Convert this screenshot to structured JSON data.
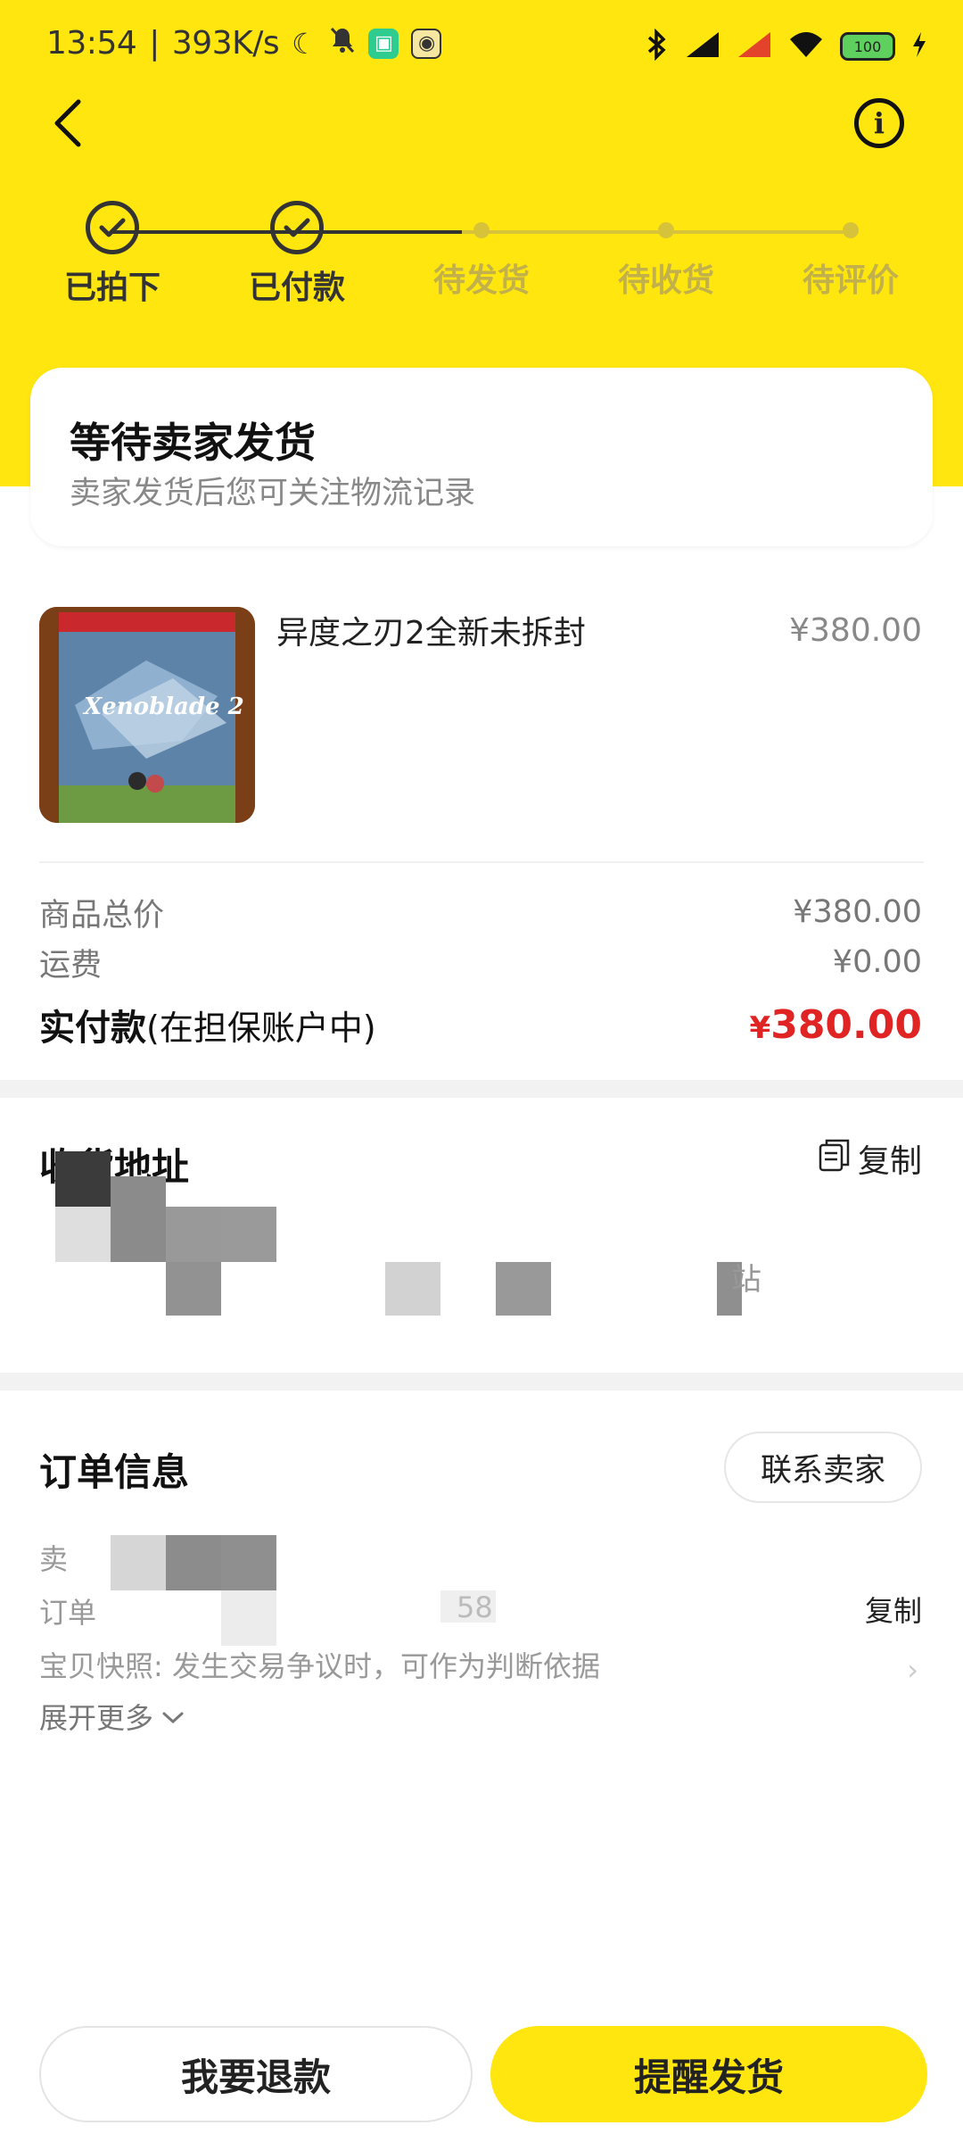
{
  "status_bar": {
    "time": "13:54",
    "separator": "|",
    "net_speed": "393K/s",
    "battery_level": "100",
    "icons": [
      "moon-icon",
      "bell-mute-icon",
      "shield-app-icon",
      "camera-app-icon",
      "bluetooth-icon",
      "signal-icon",
      "signal-2-icon",
      "wifi-icon",
      "battery-icon",
      "charging-icon"
    ]
  },
  "steps": [
    {
      "label": "已拍下",
      "done": true
    },
    {
      "label": "已付款",
      "done": true
    },
    {
      "label": "待发货",
      "done": false
    },
    {
      "label": "待收货",
      "done": false
    },
    {
      "label": "待评价",
      "done": false
    }
  ],
  "status_card": {
    "title": "等待卖家发货",
    "subtitle": "卖家发货后您可关注物流记录"
  },
  "product": {
    "title": "异度之刃2全新未拆封",
    "price": "¥380.00",
    "cover_text": "Xenoblade 2"
  },
  "summary": {
    "goods_total_label": "商品总价",
    "goods_total_value": "¥380.00",
    "shipping_label": "运费",
    "shipping_value": "¥0.00",
    "paid_label": "实付款",
    "paid_note": "(在担保账户中)",
    "paid_currency": "¥",
    "paid_value": "380.00"
  },
  "address": {
    "title": "收货地址",
    "copy_label": "复制",
    "tail_char": "站"
  },
  "order_info": {
    "title": "订单信息",
    "contact_label": "联系卖家",
    "seller_prefix": "卖",
    "order_prefix": "订单",
    "order_tail": "58",
    "copy_label": "复制",
    "snapshot_text": "宝贝快照:  发生交易争议时，可作为判断依据",
    "expand_label": "展开更多"
  },
  "actions": {
    "refund_label": "我要退款",
    "remind_label": "提醒发货"
  },
  "colors": {
    "brand_yellow": "#FFE60F",
    "price_red": "#E02424"
  }
}
